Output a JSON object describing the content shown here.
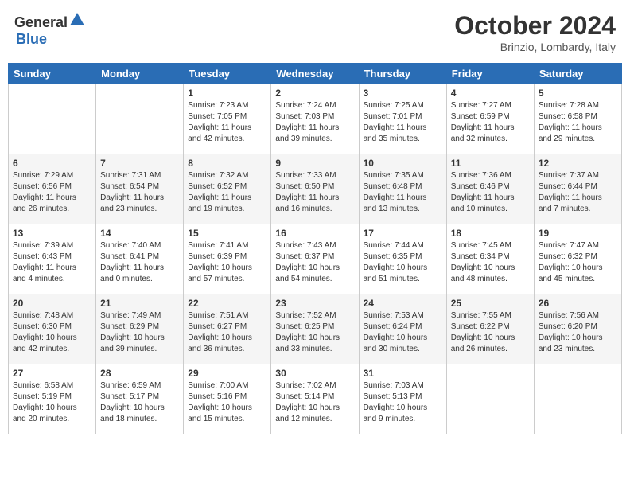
{
  "header": {
    "logo_general": "General",
    "logo_blue": "Blue",
    "title": "October 2024",
    "location": "Brinzio, Lombardy, Italy"
  },
  "days_of_week": [
    "Sunday",
    "Monday",
    "Tuesday",
    "Wednesday",
    "Thursday",
    "Friday",
    "Saturday"
  ],
  "weeks": [
    [
      {
        "num": "",
        "sunrise": "",
        "sunset": "",
        "daylight": ""
      },
      {
        "num": "",
        "sunrise": "",
        "sunset": "",
        "daylight": ""
      },
      {
        "num": "1",
        "sunrise": "Sunrise: 7:23 AM",
        "sunset": "Sunset: 7:05 PM",
        "daylight": "Daylight: 11 hours and 42 minutes."
      },
      {
        "num": "2",
        "sunrise": "Sunrise: 7:24 AM",
        "sunset": "Sunset: 7:03 PM",
        "daylight": "Daylight: 11 hours and 39 minutes."
      },
      {
        "num": "3",
        "sunrise": "Sunrise: 7:25 AM",
        "sunset": "Sunset: 7:01 PM",
        "daylight": "Daylight: 11 hours and 35 minutes."
      },
      {
        "num": "4",
        "sunrise": "Sunrise: 7:27 AM",
        "sunset": "Sunset: 6:59 PM",
        "daylight": "Daylight: 11 hours and 32 minutes."
      },
      {
        "num": "5",
        "sunrise": "Sunrise: 7:28 AM",
        "sunset": "Sunset: 6:58 PM",
        "daylight": "Daylight: 11 hours and 29 minutes."
      }
    ],
    [
      {
        "num": "6",
        "sunrise": "Sunrise: 7:29 AM",
        "sunset": "Sunset: 6:56 PM",
        "daylight": "Daylight: 11 hours and 26 minutes."
      },
      {
        "num": "7",
        "sunrise": "Sunrise: 7:31 AM",
        "sunset": "Sunset: 6:54 PM",
        "daylight": "Daylight: 11 hours and 23 minutes."
      },
      {
        "num": "8",
        "sunrise": "Sunrise: 7:32 AM",
        "sunset": "Sunset: 6:52 PM",
        "daylight": "Daylight: 11 hours and 19 minutes."
      },
      {
        "num": "9",
        "sunrise": "Sunrise: 7:33 AM",
        "sunset": "Sunset: 6:50 PM",
        "daylight": "Daylight: 11 hours and 16 minutes."
      },
      {
        "num": "10",
        "sunrise": "Sunrise: 7:35 AM",
        "sunset": "Sunset: 6:48 PM",
        "daylight": "Daylight: 11 hours and 13 minutes."
      },
      {
        "num": "11",
        "sunrise": "Sunrise: 7:36 AM",
        "sunset": "Sunset: 6:46 PM",
        "daylight": "Daylight: 11 hours and 10 minutes."
      },
      {
        "num": "12",
        "sunrise": "Sunrise: 7:37 AM",
        "sunset": "Sunset: 6:44 PM",
        "daylight": "Daylight: 11 hours and 7 minutes."
      }
    ],
    [
      {
        "num": "13",
        "sunrise": "Sunrise: 7:39 AM",
        "sunset": "Sunset: 6:43 PM",
        "daylight": "Daylight: 11 hours and 4 minutes."
      },
      {
        "num": "14",
        "sunrise": "Sunrise: 7:40 AM",
        "sunset": "Sunset: 6:41 PM",
        "daylight": "Daylight: 11 hours and 0 minutes."
      },
      {
        "num": "15",
        "sunrise": "Sunrise: 7:41 AM",
        "sunset": "Sunset: 6:39 PM",
        "daylight": "Daylight: 10 hours and 57 minutes."
      },
      {
        "num": "16",
        "sunrise": "Sunrise: 7:43 AM",
        "sunset": "Sunset: 6:37 PM",
        "daylight": "Daylight: 10 hours and 54 minutes."
      },
      {
        "num": "17",
        "sunrise": "Sunrise: 7:44 AM",
        "sunset": "Sunset: 6:35 PM",
        "daylight": "Daylight: 10 hours and 51 minutes."
      },
      {
        "num": "18",
        "sunrise": "Sunrise: 7:45 AM",
        "sunset": "Sunset: 6:34 PM",
        "daylight": "Daylight: 10 hours and 48 minutes."
      },
      {
        "num": "19",
        "sunrise": "Sunrise: 7:47 AM",
        "sunset": "Sunset: 6:32 PM",
        "daylight": "Daylight: 10 hours and 45 minutes."
      }
    ],
    [
      {
        "num": "20",
        "sunrise": "Sunrise: 7:48 AM",
        "sunset": "Sunset: 6:30 PM",
        "daylight": "Daylight: 10 hours and 42 minutes."
      },
      {
        "num": "21",
        "sunrise": "Sunrise: 7:49 AM",
        "sunset": "Sunset: 6:29 PM",
        "daylight": "Daylight: 10 hours and 39 minutes."
      },
      {
        "num": "22",
        "sunrise": "Sunrise: 7:51 AM",
        "sunset": "Sunset: 6:27 PM",
        "daylight": "Daylight: 10 hours and 36 minutes."
      },
      {
        "num": "23",
        "sunrise": "Sunrise: 7:52 AM",
        "sunset": "Sunset: 6:25 PM",
        "daylight": "Daylight: 10 hours and 33 minutes."
      },
      {
        "num": "24",
        "sunrise": "Sunrise: 7:53 AM",
        "sunset": "Sunset: 6:24 PM",
        "daylight": "Daylight: 10 hours and 30 minutes."
      },
      {
        "num": "25",
        "sunrise": "Sunrise: 7:55 AM",
        "sunset": "Sunset: 6:22 PM",
        "daylight": "Daylight: 10 hours and 26 minutes."
      },
      {
        "num": "26",
        "sunrise": "Sunrise: 7:56 AM",
        "sunset": "Sunset: 6:20 PM",
        "daylight": "Daylight: 10 hours and 23 minutes."
      }
    ],
    [
      {
        "num": "27",
        "sunrise": "Sunrise: 6:58 AM",
        "sunset": "Sunset: 5:19 PM",
        "daylight": "Daylight: 10 hours and 20 minutes."
      },
      {
        "num": "28",
        "sunrise": "Sunrise: 6:59 AM",
        "sunset": "Sunset: 5:17 PM",
        "daylight": "Daylight: 10 hours and 18 minutes."
      },
      {
        "num": "29",
        "sunrise": "Sunrise: 7:00 AM",
        "sunset": "Sunset: 5:16 PM",
        "daylight": "Daylight: 10 hours and 15 minutes."
      },
      {
        "num": "30",
        "sunrise": "Sunrise: 7:02 AM",
        "sunset": "Sunset: 5:14 PM",
        "daylight": "Daylight: 10 hours and 12 minutes."
      },
      {
        "num": "31",
        "sunrise": "Sunrise: 7:03 AM",
        "sunset": "Sunset: 5:13 PM",
        "daylight": "Daylight: 10 hours and 9 minutes."
      },
      {
        "num": "",
        "sunrise": "",
        "sunset": "",
        "daylight": ""
      },
      {
        "num": "",
        "sunrise": "",
        "sunset": "",
        "daylight": ""
      }
    ]
  ]
}
